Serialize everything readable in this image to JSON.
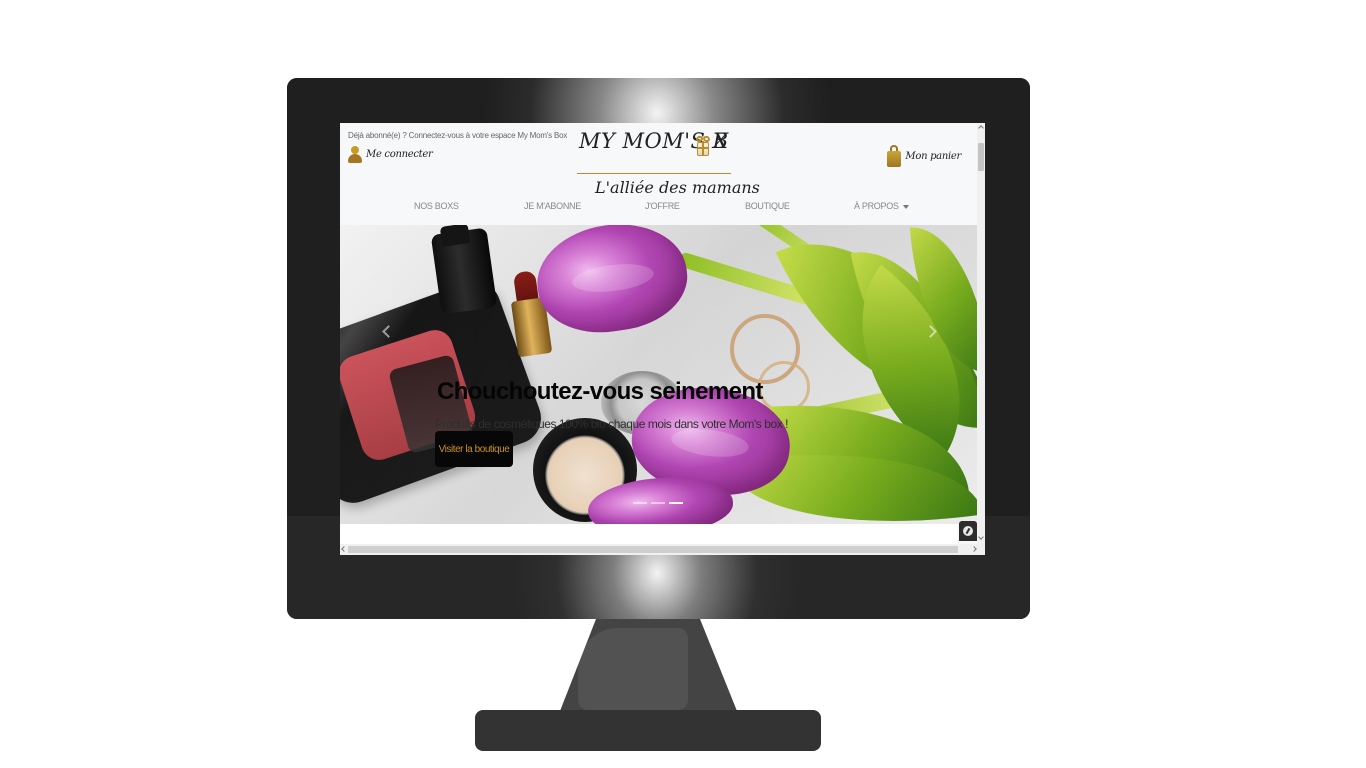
{
  "site": {
    "top_notice": "Déjà abonné(e) ? Connectez-vous à votre espace My Mom's Box",
    "login_label": "Me connecter",
    "cart_label": "Mon panier",
    "logo": {
      "wordmark_left": "MY MOM'S B",
      "wordmark_right": "X",
      "tagline": "L'alliée des mamans"
    },
    "nav": [
      {
        "label": "NOS BOXS"
      },
      {
        "label": "JE M'ABONNE"
      },
      {
        "label": "J'OFFRE"
      },
      {
        "label": "BOUTIQUE"
      },
      {
        "label": "À PROPOS"
      }
    ]
  },
  "hero": {
    "title": "Chouchoutez-vous seinement",
    "subtitle": "Produits de cosmétiques 100% bio chaque mois dans votre Mom's box !",
    "cta_label": "Visiter la boutique",
    "slides_total": 3,
    "active_slide": 3
  },
  "colors": {
    "accent_gold": "#b88b2e",
    "cta_text": "#c89224",
    "nav_text": "#888888",
    "hero_title": "#050505"
  },
  "icons": {
    "login": "user-icon",
    "cart": "shopping-bag-icon",
    "logo_gift": "gift-icon",
    "dropdown": "caret-down-icon",
    "carousel_prev": "chevron-left-icon",
    "carousel_next": "chevron-right-icon",
    "chat": "chat-icon"
  }
}
